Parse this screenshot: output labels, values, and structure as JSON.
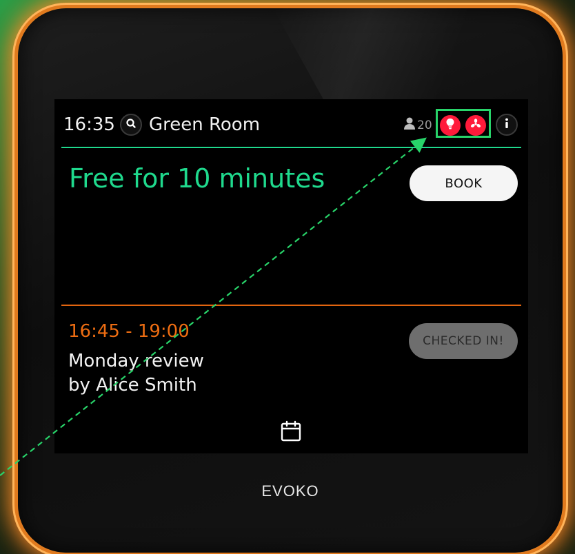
{
  "brand": "EVOKO",
  "topbar": {
    "time": "16:35",
    "room_name": "Green Room",
    "capacity": "20"
  },
  "status": {
    "message": "Free for 10 minutes",
    "book_label": "BOOK"
  },
  "meeting": {
    "time": "16:45 - 19:00",
    "title": "Monday review",
    "organizer": "by Alice Smith",
    "checkin_label": "CHECKED IN!"
  },
  "icons": {
    "search": "search-icon",
    "capacity": "person-icon",
    "light": "lightbulb-icon",
    "fan": "fan-icon",
    "info": "info-icon",
    "calendar": "calendar-icon"
  },
  "colors": {
    "free_green": "#1fd98d",
    "meeting_orange": "#ee6d12",
    "alert_red": "#ff1a3a",
    "highlight_green": "#28d46a",
    "device_glow": "#ff8c28"
  }
}
